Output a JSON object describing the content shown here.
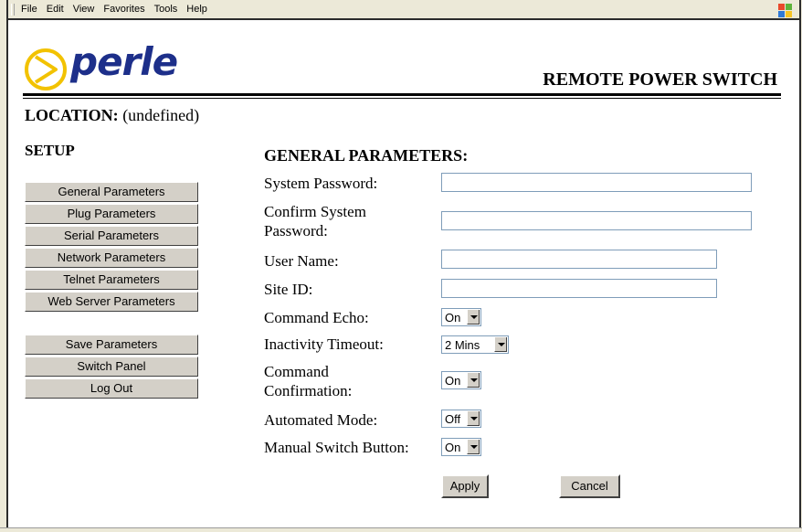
{
  "menu": [
    "File",
    "Edit",
    "View",
    "Favorites",
    "Tools",
    "Help"
  ],
  "logo": {
    "text": "perle",
    "icon": "perle-logo-icon"
  },
  "header": {
    "product_title": "REMOTE POWER SWITCH"
  },
  "location": {
    "label": "LOCATION:",
    "value": "(undefined)"
  },
  "sidebar": {
    "heading": "SETUP",
    "items": [
      "General Parameters",
      "Plug Parameters",
      "Serial Parameters",
      "Network Parameters",
      "Telnet Parameters",
      "Web Server Parameters"
    ],
    "actions": [
      "Save Parameters",
      "Switch Panel",
      "Log Out"
    ]
  },
  "form": {
    "title": "GENERAL PARAMETERS:",
    "system_password": {
      "label": "System Password:",
      "value": ""
    },
    "confirm_password": {
      "label_line1": "Confirm System",
      "label_line2": "Password:",
      "value": ""
    },
    "user_name": {
      "label": "User Name:",
      "value": ""
    },
    "site_id": {
      "label": "Site ID:",
      "value": ""
    },
    "command_echo": {
      "label": "Command Echo:",
      "value": "On"
    },
    "inactivity_timeout": {
      "label": "Inactivity Timeout:",
      "value": "2 Mins"
    },
    "command_confirmation": {
      "label_line1": "Command",
      "label_line2": "Confirmation:",
      "value": "On"
    },
    "automated_mode": {
      "label": "Automated Mode:",
      "value": "Off"
    },
    "manual_switch": {
      "label": "Manual Switch Button:",
      "value": "On"
    },
    "apply_label": "Apply",
    "cancel_label": "Cancel"
  },
  "colors": {
    "brand": "#1d2f8a",
    "logo_ring": "#f2c200",
    "button_face": "#d4d0c8"
  }
}
